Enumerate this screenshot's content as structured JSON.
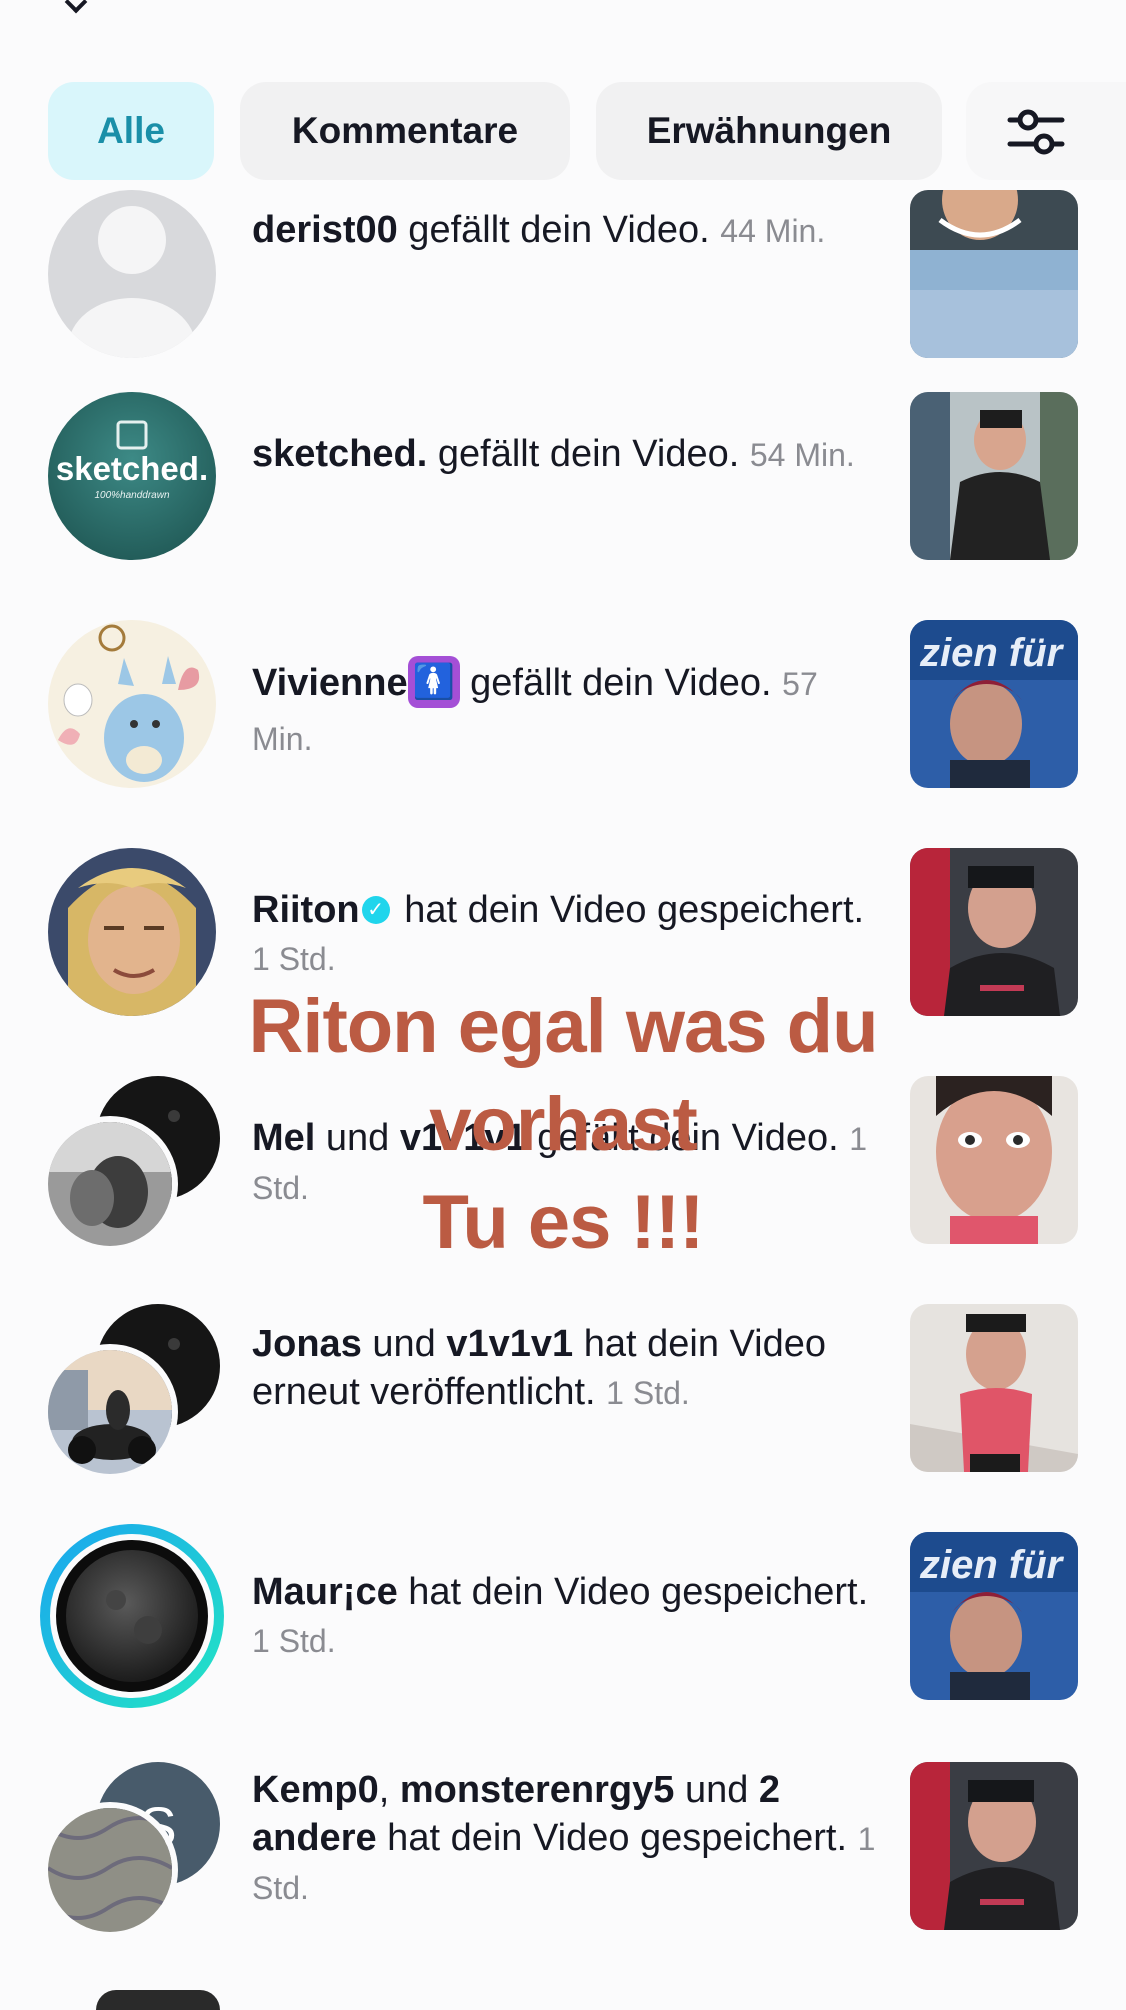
{
  "tabs": [
    {
      "label": "Alle",
      "active": true
    },
    {
      "label": "Kommentare",
      "active": false
    },
    {
      "label": "Erwähnungen",
      "active": false
    }
  ],
  "filter_icon": "sliders-icon",
  "notifications": [
    {
      "user": "derist00",
      "action": " gefällt dein Video. ",
      "time": "44 Min."
    },
    {
      "user": "sketched.",
      "action": " gefällt dein Video. ",
      "time": "54 Min.",
      "avatar_text": "sketched.",
      "avatar_subtext": "100%handdrawn"
    },
    {
      "user": "Vivienne",
      "emoji": "🚺",
      "action": " gefällt dein Video. ",
      "time": "57 Min."
    },
    {
      "user": "Riiton",
      "verified": true,
      "action": " hat dein Video gespeichert. ",
      "time": "1 Std."
    },
    {
      "user": "Mel",
      "join": " und ",
      "user2": "v1v1v1",
      "action": " gefällt dein Video. ",
      "time": "1 Std."
    },
    {
      "user": "Jonas",
      "join": " und ",
      "user2": "v1v1v1",
      "action": " hat dein Video erneut veröffentlicht. ",
      "time": "1 Std."
    },
    {
      "user": "Maur¡ce",
      "action": " hat dein Video gespeichert. ",
      "time": "1 Std."
    },
    {
      "user": "Kemp0",
      "sep": ", ",
      "user2": "monsterenrgy5",
      "join": " und ",
      "count": "2 andere",
      "action": " hat dein Video gespeichert. ",
      "time": "1 Std.",
      "avatar_letter": "S"
    }
  ],
  "overlay_text": [
    "Riton egal was du",
    "vorhast",
    "Tu es !!!"
  ],
  "colors": {
    "accent_tab_bg": "#d9f6fb",
    "accent_tab_text": "#1a8fa8",
    "overlay_text": "#bb5b43",
    "verified": "#20d5ec"
  }
}
